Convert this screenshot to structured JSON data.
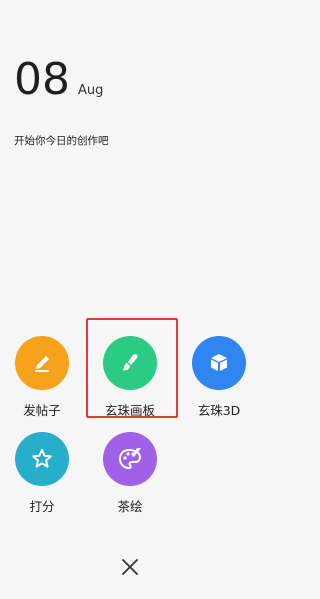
{
  "header": {
    "day": "08",
    "month": "Aug",
    "prompt": "开始你今日的创作吧"
  },
  "actions": [
    {
      "label": "发帖子",
      "icon": "pencil-icon",
      "color": "#f6a21a"
    },
    {
      "label": "玄珠画板",
      "icon": "paintbrush-icon",
      "color": "#2ccb83"
    },
    {
      "label": "玄珠3D",
      "icon": "cube-icon",
      "color": "#2f86f0"
    },
    {
      "label": "打分",
      "icon": "star-icon",
      "color": "#27aecb"
    },
    {
      "label": "茶绘",
      "icon": "palette-icon",
      "color": "#a060e8"
    }
  ],
  "close_icon": "close-icon"
}
